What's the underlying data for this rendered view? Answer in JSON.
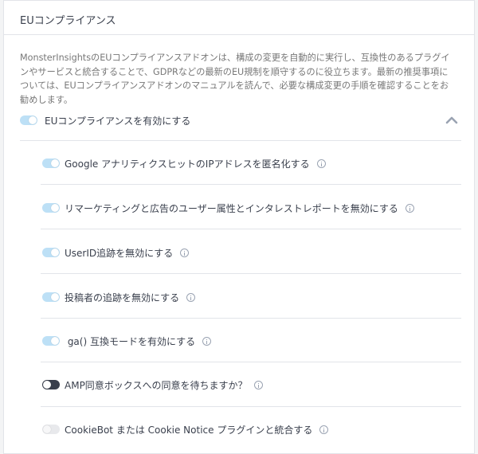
{
  "panel": {
    "title": "EUコンプライアンス",
    "description": "MonsterInsightsのEUコンプライアンスアドオンは、構成の変更を自動的に実行し、互換性のあるプラグインやサービスと統合することで、GDPRなどの最新のEU規制を順守するのに役立ちます。最新の推奨事項については、EUコンプライアンスアドオンのマニュアルを読んで、必要な構成変更の手順を確認することをお勧めします。"
  },
  "master_toggle": {
    "label": "EUコンプライアンスを有効にする",
    "enabled": true
  },
  "settings": [
    {
      "label": "Google アナリティクスヒットのIPアドレスを匿名化する",
      "state": "on"
    },
    {
      "label": "リマーケティングと広告のユーザー属性とインタレストレポートを無効にする",
      "state": "on"
    },
    {
      "label": "UserID追跡を無効にする",
      "state": "on"
    },
    {
      "label": "投稿者の追跡を無効にする",
      "state": "on"
    },
    {
      "label": " ga() 互換モードを有効にする",
      "state": "on"
    },
    {
      "label": "AMP同意ボックスへの同意を待ちますか？",
      "state": "off"
    },
    {
      "label": "CookieBot または Cookie Notice プラグインと統合する",
      "state": "disabled"
    }
  ],
  "icons": {
    "collapse": "chevron-up-icon",
    "help": "info-circle-icon"
  },
  "colors": {
    "toggle_on": "#bde0f6",
    "toggle_off": "#393f4c",
    "toggle_disabled": "#e8e9ec",
    "text": "#393f4c",
    "muted_text": "#777777"
  }
}
